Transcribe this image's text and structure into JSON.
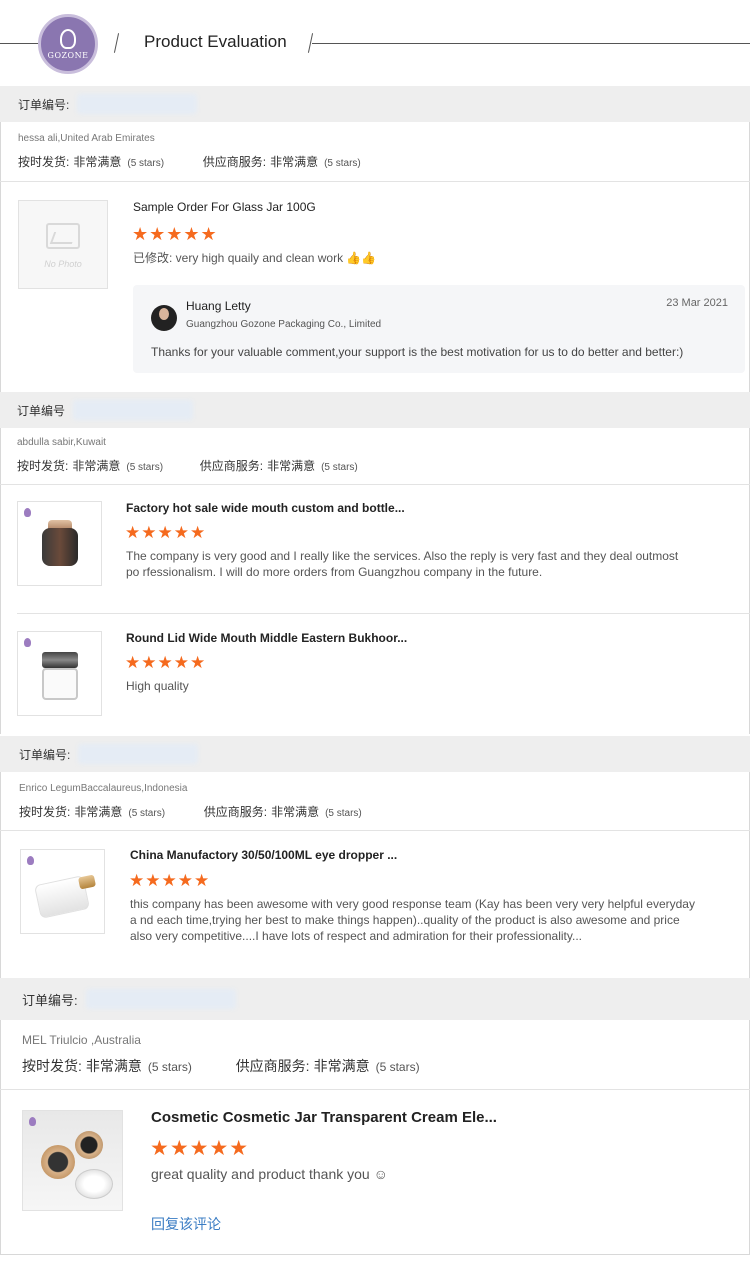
{
  "header": {
    "logo_brand": "GOZONE",
    "title": "Product Evaluation"
  },
  "orders": [
    {
      "order_label": "订单编号:",
      "buyer": "hessa ali,United Arab Emirates",
      "shipping_label": "按时发货:",
      "shipping_value": "非常满意",
      "shipping_stars": "(5 stars)",
      "service_label": "供应商服务:",
      "service_value": "非常满意",
      "service_stars": "(5 stars)",
      "items": [
        {
          "image": "no-photo",
          "image_text": "No Photo",
          "title": "Sample Order For Glass Jar 100G",
          "stars": "★★★★★",
          "comment": "已修改: very high quaily and clean work 👍👍",
          "reply": {
            "name": "Huang Letty",
            "company": "Guangzhou Gozone Packaging Co., Limited",
            "date": "23 Mar 2021",
            "text": "Thanks for your valuable comment,your support is the best motivation for us to do better and better:)"
          }
        }
      ]
    },
    {
      "order_label": "订单编号",
      "buyer": "abdulla sabir,Kuwait",
      "shipping_label": "按时发货:",
      "shipping_value": "非常满意",
      "shipping_stars": "(5 stars)",
      "service_label": "供应商服务:",
      "service_value": "非常满意",
      "service_stars": "(5 stars)",
      "items": [
        {
          "title": "Factory hot sale wide mouth custom and bottle...",
          "stars": "★★★★★",
          "comment": "The company is very good and I really like the services. Also the reply is very fast and they deal outmost po rfessionalism. I will do more orders from Guangzhou company in the future."
        },
        {
          "title": "Round Lid Wide Mouth Middle Eastern Bukhoor...",
          "stars": "★★★★★",
          "comment": "High quality"
        }
      ]
    },
    {
      "order_label": "订单编号:",
      "buyer": "Enrico LegumBaccalaureus,Indonesia",
      "shipping_label": "按时发货:",
      "shipping_value": "非常满意",
      "shipping_stars": "(5 stars)",
      "service_label": "供应商服务:",
      "service_value": "非常满意",
      "service_stars": "(5 stars)",
      "items": [
        {
          "title": "China Manufactory 30/50/100ML eye dropper ...",
          "stars": "★★★★★",
          "comment": "this company has been awesome with very good response team (Kay has been very very helpful everyday a nd each time,trying her best to make things happen)..quality of the product is also awesome and price also very competitive....I have lots of respect and admiration for their professionality..."
        }
      ]
    },
    {
      "order_label": "订单编号:",
      "buyer": "MEL Triulcio ,Australia",
      "shipping_label": "按时发货:",
      "shipping_value": "非常满意",
      "shipping_stars": "(5 stars)",
      "service_label": "供应商服务:",
      "service_value": "非常满意",
      "service_stars": "(5 stars)",
      "items": [
        {
          "title": "Cosmetic Cosmetic Jar Transparent Cream Ele...",
          "stars": "★★★★★",
          "comment": "great quality and product thank you ☺",
          "reply_link": "回复该评论"
        }
      ]
    }
  ]
}
